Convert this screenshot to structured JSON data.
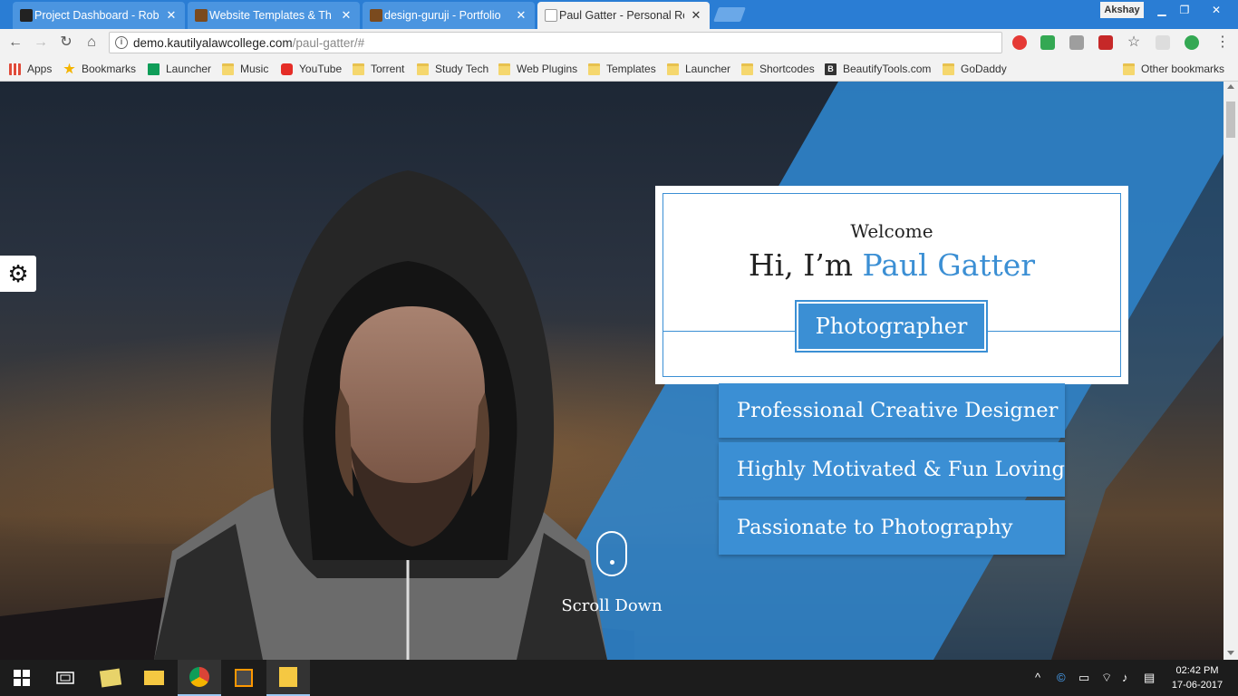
{
  "browser": {
    "tabs": [
      {
        "title": "Project Dashboard - Rob",
        "favicon_color": "#222222",
        "active": false
      },
      {
        "title": "Website Templates & Th",
        "favicon_color": "#7a4a1e",
        "active": false
      },
      {
        "title": "design-guruji - Portfolio",
        "favicon_color": "#7a4a1e",
        "active": false
      },
      {
        "title": "Paul Gatter - Personal Re",
        "favicon_color": "#ffffff",
        "active": true
      }
    ],
    "profile": "Akshay",
    "url_domain": "demo.kautilyalawcollege.com",
    "url_path": "/paul-gatter/#",
    "bookmarks": [
      {
        "label": "Apps",
        "icon": "apps-grid-icon",
        "color": "#e04b3a"
      },
      {
        "label": "Bookmarks",
        "icon": "star-icon",
        "color": "#f4b400"
      },
      {
        "label": "Launcher",
        "icon": "sheets-icon",
        "color": "#0f9d58"
      },
      {
        "label": "Music",
        "icon": "folder-icon",
        "color": "#f5d76e"
      },
      {
        "label": "YouTube",
        "icon": "youtube-icon",
        "color": "#e52d27"
      },
      {
        "label": "Torrent",
        "icon": "folder-icon",
        "color": "#f5d76e"
      },
      {
        "label": "Study Tech",
        "icon": "folder-icon",
        "color": "#f5d76e"
      },
      {
        "label": "Web Plugins",
        "icon": "folder-icon",
        "color": "#f5d76e"
      },
      {
        "label": "Templates",
        "icon": "folder-icon",
        "color": "#f5d76e"
      },
      {
        "label": "Launcher",
        "icon": "folder-icon",
        "color": "#f5d76e"
      },
      {
        "label": "Shortcodes",
        "icon": "folder-icon",
        "color": "#f5d76e"
      },
      {
        "label": "BeautifyTools.com",
        "icon": "bt-icon",
        "color": "#333333"
      },
      {
        "label": "GoDaddy",
        "icon": "folder-icon",
        "color": "#f5d76e"
      },
      {
        "label": "Other bookmarks",
        "icon": "folder-icon",
        "color": "#f5d76e"
      }
    ]
  },
  "hero": {
    "welcome": "Welcome",
    "greeting": "Hi, I’m",
    "name": "Paul Gatter",
    "role": "Photographer",
    "taglines": [
      "Professional Creative Designer",
      "Highly Motivated & Fun Loving",
      "Passionate to Photography"
    ],
    "scroll_label": "Scroll Down",
    "accent_color": "#3b8fd4"
  },
  "taskbar": {
    "time": "02:42 PM",
    "date": "17-06-2017"
  }
}
